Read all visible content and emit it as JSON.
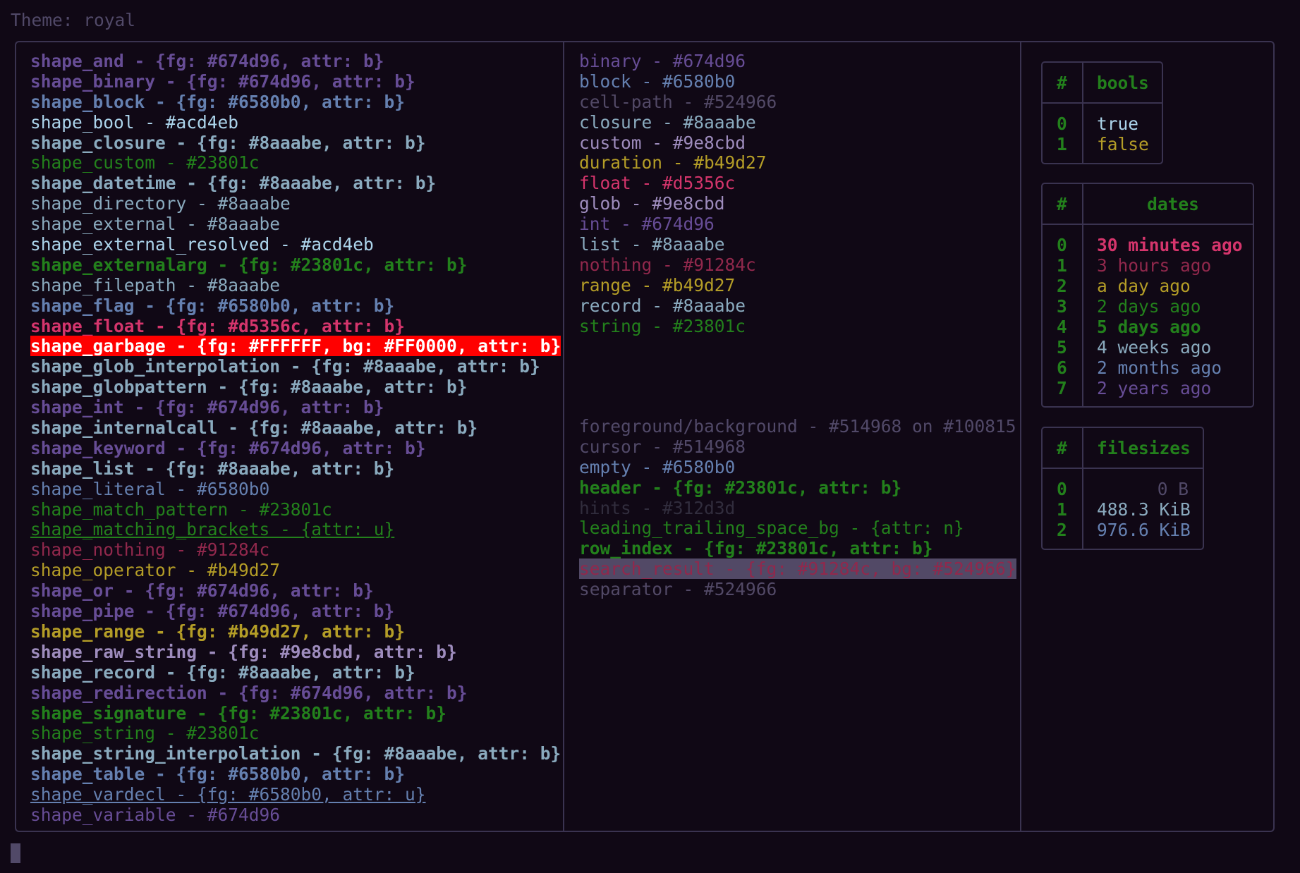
{
  "theme_title": "Theme: royal",
  "left_column": [
    {
      "text": "shape_and - {fg: #674d96, attr: b}",
      "color": "#674d96",
      "bold": true
    },
    {
      "text": "shape_binary - {fg: #674d96, attr: b}",
      "color": "#674d96",
      "bold": true
    },
    {
      "text": "shape_block - {fg: #6580b0, attr: b}",
      "color": "#6580b0",
      "bold": true
    },
    {
      "text": "shape_bool - #acd4eb",
      "color": "#acd4eb",
      "bold": false
    },
    {
      "text": "shape_closure - {fg: #8aaabe, attr: b}",
      "color": "#8aaabe",
      "bold": true
    },
    {
      "text": "shape_custom - #23801c",
      "color": "#23801c",
      "bold": false
    },
    {
      "text": "shape_datetime - {fg: #8aaabe, attr: b}",
      "color": "#8aaabe",
      "bold": true
    },
    {
      "text": "shape_directory - #8aaabe",
      "color": "#8aaabe",
      "bold": false
    },
    {
      "text": "shape_external - #8aaabe",
      "color": "#8aaabe",
      "bold": false
    },
    {
      "text": "shape_external_resolved - #acd4eb",
      "color": "#acd4eb",
      "bold": false
    },
    {
      "text": "shape_externalarg - {fg: #23801c, attr: b}",
      "color": "#23801c",
      "bold": true
    },
    {
      "text": "shape_filepath - #8aaabe",
      "color": "#8aaabe",
      "bold": false
    },
    {
      "text": "shape_flag - {fg: #6580b0, attr: b}",
      "color": "#6580b0",
      "bold": true
    },
    {
      "text": "shape_float - {fg: #d5356c, attr: b}",
      "color": "#d5356c",
      "bold": true
    },
    {
      "text": "shape_garbage - {fg: #FFFFFF, bg: #FF0000, attr: b}",
      "color": "#FFFFFF",
      "bg": "#FF0000",
      "bold": true
    },
    {
      "text": "shape_glob_interpolation - {fg: #8aaabe, attr: b}",
      "color": "#8aaabe",
      "bold": true
    },
    {
      "text": "shape_globpattern - {fg: #8aaabe, attr: b}",
      "color": "#8aaabe",
      "bold": true
    },
    {
      "text": "shape_int - {fg: #674d96, attr: b}",
      "color": "#674d96",
      "bold": true
    },
    {
      "text": "shape_internalcall - {fg: #8aaabe, attr: b}",
      "color": "#8aaabe",
      "bold": true
    },
    {
      "text": "shape_keyword - {fg: #674d96, attr: b}",
      "color": "#674d96",
      "bold": true
    },
    {
      "text": "shape_list - {fg: #8aaabe, attr: b}",
      "color": "#8aaabe",
      "bold": true
    },
    {
      "text": "shape_literal - #6580b0",
      "color": "#6580b0",
      "bold": false
    },
    {
      "text": "shape_match_pattern - #23801c",
      "color": "#23801c",
      "bold": false
    },
    {
      "text": "shape_matching_brackets - {attr: u}",
      "color": "#23801c",
      "bold": false,
      "underline": true
    },
    {
      "text": "shape_nothing - #91284c",
      "color": "#91284c",
      "bold": false
    },
    {
      "text": "shape_operator - #b49d27",
      "color": "#b49d27",
      "bold": false
    },
    {
      "text": "shape_or - {fg: #674d96, attr: b}",
      "color": "#674d96",
      "bold": true
    },
    {
      "text": "shape_pipe - {fg: #674d96, attr: b}",
      "color": "#674d96",
      "bold": true
    },
    {
      "text": "shape_range - {fg: #b49d27, attr: b}",
      "color": "#b49d27",
      "bold": true
    },
    {
      "text": "shape_raw_string - {fg: #9e8cbd, attr: b}",
      "color": "#9e8cbd",
      "bold": true
    },
    {
      "text": "shape_record - {fg: #8aaabe, attr: b}",
      "color": "#8aaabe",
      "bold": true
    },
    {
      "text": "shape_redirection - {fg: #674d96, attr: b}",
      "color": "#674d96",
      "bold": true
    },
    {
      "text": "shape_signature - {fg: #23801c, attr: b}",
      "color": "#23801c",
      "bold": true
    },
    {
      "text": "shape_string - #23801c",
      "color": "#23801c",
      "bold": false
    },
    {
      "text": "shape_string_interpolation - {fg: #8aaabe, attr: b}",
      "color": "#8aaabe",
      "bold": true
    },
    {
      "text": "shape_table - {fg: #6580b0, attr: b}",
      "color": "#6580b0",
      "bold": true
    },
    {
      "text": "shape_vardecl - {fg: #6580b0, attr: u}",
      "color": "#6580b0",
      "bold": false,
      "underline": true
    },
    {
      "text": "shape_variable - #674d96",
      "color": "#674d96",
      "bold": false
    }
  ],
  "middle_column_top": [
    {
      "text": "binary - #674d96",
      "color": "#674d96",
      "bold": false
    },
    {
      "text": "block - #6580b0",
      "color": "#6580b0",
      "bold": false
    },
    {
      "text": "cell-path - #524966",
      "color": "#524966",
      "bold": false
    },
    {
      "text": "closure - #8aaabe",
      "color": "#8aaabe",
      "bold": false
    },
    {
      "text": "custom - #9e8cbd",
      "color": "#9e8cbd",
      "bold": false
    },
    {
      "text": "duration - #b49d27",
      "color": "#b49d27",
      "bold": false
    },
    {
      "text": "float - #d5356c",
      "color": "#d5356c",
      "bold": false
    },
    {
      "text": "glob - #9e8cbd",
      "color": "#9e8cbd",
      "bold": false
    },
    {
      "text": "int - #674d96",
      "color": "#674d96",
      "bold": false
    },
    {
      "text": "list - #8aaabe",
      "color": "#8aaabe",
      "bold": false
    },
    {
      "text": "nothing - #91284c",
      "color": "#91284c",
      "bold": false
    },
    {
      "text": "range - #b49d27",
      "color": "#b49d27",
      "bold": false
    },
    {
      "text": "record - #8aaabe",
      "color": "#8aaabe",
      "bold": false
    },
    {
      "text": "string - #23801c",
      "color": "#23801c",
      "bold": false
    }
  ],
  "middle_column_bottom": [
    {
      "text": "foreground/background - #514968 on #100815",
      "color": "#514968",
      "bold": false
    },
    {
      "text": "cursor - #514968",
      "color": "#514968",
      "bold": false
    },
    {
      "text": "empty - #6580b0",
      "color": "#6580b0",
      "bold": false
    },
    {
      "text": "header - {fg: #23801c, attr: b}",
      "color": "#23801c",
      "bold": true
    },
    {
      "text": "hints - #312d3d",
      "color": "#312d3d",
      "bold": false
    },
    {
      "text": "leading_trailing_space_bg - {attr: n}",
      "color": "#23801c",
      "bold": false
    },
    {
      "text": "row_index - {fg: #23801c, attr: b}",
      "color": "#23801c",
      "bold": true
    },
    {
      "text": "search_result - {fg: #91284c, bg: #524966}",
      "color": "#91284c",
      "bg": "#524966",
      "bold": false
    },
    {
      "text": "separator - #524966",
      "color": "#524966",
      "bold": false
    }
  ],
  "tables": {
    "bools": {
      "index_header": "#",
      "header": "bools",
      "rows": [
        {
          "idx": "0",
          "value": "true",
          "color": "#acd4eb",
          "bold": false
        },
        {
          "idx": "1",
          "value": "false",
          "color": "#b49d27",
          "bold": false
        }
      ]
    },
    "dates": {
      "index_header": "#",
      "header": "dates",
      "rows": [
        {
          "idx": "0",
          "value": "30 minutes ago",
          "color": "#d5356c",
          "bold": true
        },
        {
          "idx": "1",
          "value": "3 hours ago",
          "color": "#91284c",
          "bold": false
        },
        {
          "idx": "2",
          "value": "a day ago",
          "color": "#b49d27",
          "bold": false
        },
        {
          "idx": "3",
          "value": "2 days ago",
          "color": "#23801c",
          "bold": false
        },
        {
          "idx": "4",
          "value": "5 days ago",
          "color": "#23801c",
          "bold": true
        },
        {
          "idx": "5",
          "value": "4 weeks ago",
          "color": "#8aaabe",
          "bold": false
        },
        {
          "idx": "6",
          "value": "2 months ago",
          "color": "#6580b0",
          "bold": false
        },
        {
          "idx": "7",
          "value": "2 years ago",
          "color": "#674d96",
          "bold": false
        }
      ]
    },
    "filesizes": {
      "index_header": "#",
      "header": "filesizes",
      "rows": [
        {
          "idx": "0",
          "value": "0 B",
          "color": "#514968",
          "bold": false
        },
        {
          "idx": "1",
          "value": "488.3 KiB",
          "color": "#8aaabe",
          "bold": false
        },
        {
          "idx": "2",
          "value": "976.6 KiB",
          "color": "#6580b0",
          "bold": false
        }
      ]
    }
  },
  "colors": {
    "background": "#100815",
    "border": "#3a3350",
    "header": "#23801c",
    "row_index": "#23801c",
    "cursor": "#514968"
  }
}
